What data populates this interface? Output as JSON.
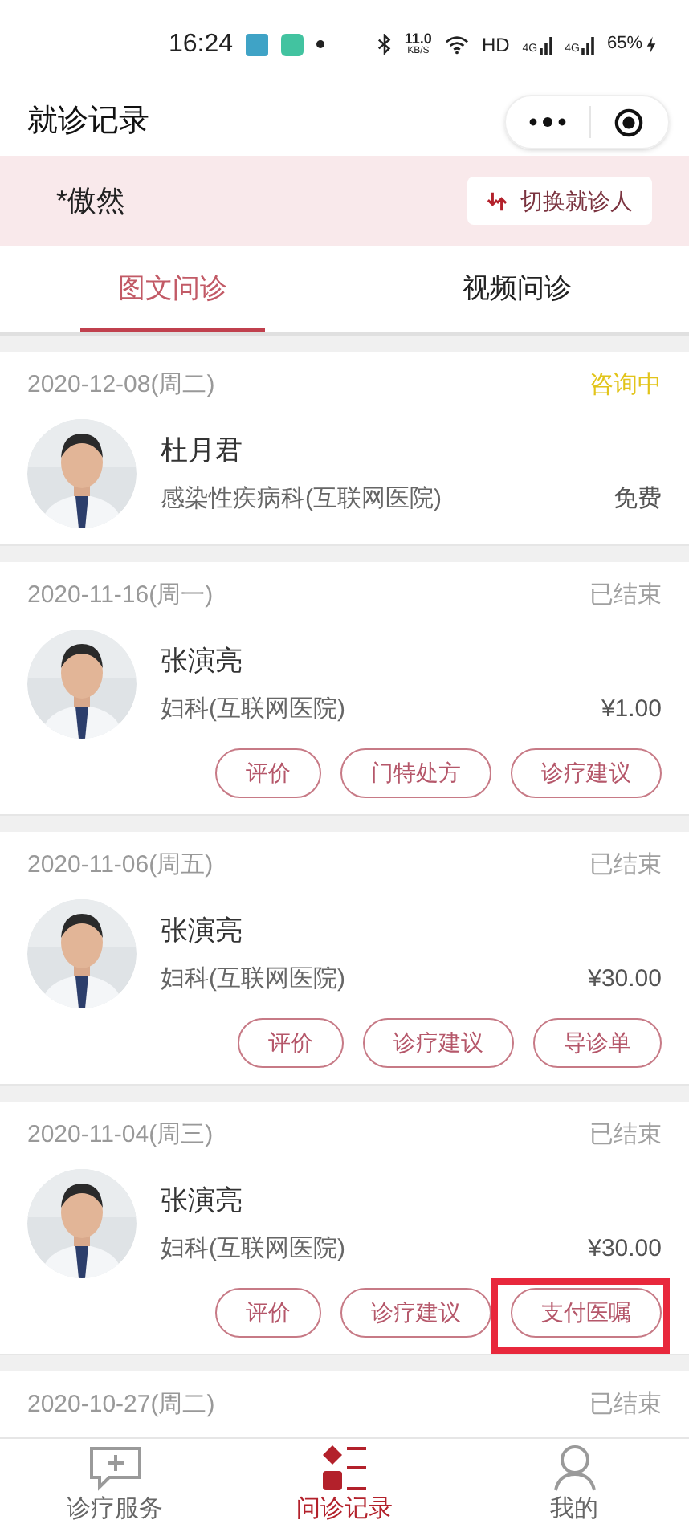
{
  "status_bar": {
    "time": "16:24",
    "net_speed": "11.0",
    "net_unit": "KB/S",
    "hd": "HD",
    "signal_1": "4G",
    "signal_2": "4G",
    "battery": "65%"
  },
  "header": {
    "title": "就诊记录"
  },
  "patient": {
    "name": "*傲然",
    "switch_label": "切换就诊人"
  },
  "tabs": [
    {
      "label": "图文问诊",
      "selected": true
    },
    {
      "label": "视频问诊",
      "selected": false
    }
  ],
  "records": [
    {
      "date": "2020-12-08(周二)",
      "status": "咨询中",
      "in_progress": true,
      "doctor": "杜月君",
      "department": "感染性疾病科(互联网医院)",
      "price": "免费",
      "highlighted": false
    },
    {
      "date": "2020-11-16(周一)",
      "status": "已结束",
      "in_progress": false,
      "doctor": "张演亮",
      "department": "妇科(互联网医院)",
      "price": "¥1.00",
      "actions": [
        "评价",
        "门特处方",
        "诊疗建议"
      ],
      "highlighted": false
    },
    {
      "date": "2020-11-06(周五)",
      "status": "已结束",
      "in_progress": false,
      "doctor": "张演亮",
      "department": "妇科(互联网医院)",
      "price": "¥30.00",
      "actions": [
        "评价",
        "诊疗建议",
        "导诊单"
      ],
      "highlighted": false
    },
    {
      "date": "2020-11-04(周三)",
      "status": "已结束",
      "in_progress": false,
      "doctor": "张演亮",
      "department": "妇科(互联网医院)",
      "price": "¥30.00",
      "actions": [
        "评价",
        "诊疗建议",
        "支付医嘱"
      ],
      "highlighted": true
    },
    {
      "date": "2020-10-27(周二)",
      "status": "已结束",
      "in_progress": false
    }
  ],
  "bottom_nav": [
    {
      "label": "诊疗服务",
      "selected": false
    },
    {
      "label": "问诊记录",
      "selected": true
    },
    {
      "label": "我的",
      "selected": false
    }
  ]
}
